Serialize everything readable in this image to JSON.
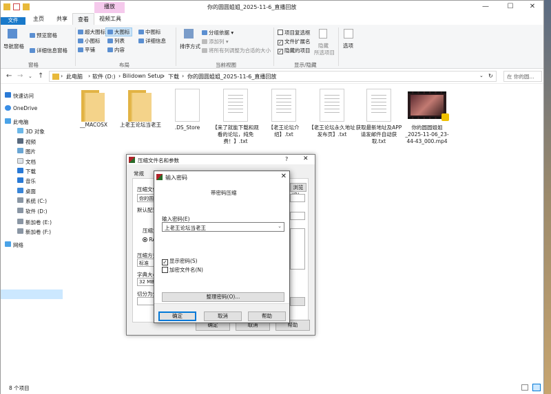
{
  "window": {
    "title": "你的圆圆姐姐_2025-11-6_直播回放",
    "context_tab": "播放",
    "caption_minimize": "—",
    "caption_maximize": "☐",
    "caption_close": "✕"
  },
  "ribbon_tabs": [
    "文件",
    "主页",
    "共享",
    "查看",
    "视频工具"
  ],
  "ribbon": {
    "nav_pane": "导航窗格",
    "preview_pane": "预览窗格",
    "details_pane": "详细信息窗格",
    "pane_group": "窗格",
    "layout_items": [
      "超大图标",
      "大图标",
      "中图标",
      "小图标",
      "列表",
      "详细信息",
      "平铺",
      "内容"
    ],
    "layout_group": "布局",
    "sort_by": "排序方式",
    "group_by": "分组依据",
    "add_columns": "添加列",
    "size_columns": "将所有列调整为合适的大小",
    "current_view_group": "当前视图",
    "item_checkboxes": "项目复选框",
    "file_extensions": "文件扩展名",
    "hidden_items": "隐藏的项目",
    "hide_selected": "隐藏",
    "hide_selected_2": "所选项目",
    "options": "选项",
    "show_hide_group": "显示/隐藏"
  },
  "address": {
    "crumbs": [
      "此电脑",
      "软件 (D:)",
      "Bilidown Setup",
      "下载",
      "你的圆圆姐姐_2025-11-6_直播回放"
    ],
    "search_placeholder": "在 你的圆..."
  },
  "sidebar": {
    "quick_access": "快速访问",
    "onedrive": "OneDrive",
    "this_pc": "此电脑",
    "items": [
      "3D 对象",
      "视频",
      "图片",
      "文档",
      "下载",
      "音乐",
      "桌面",
      "系统 (C:)",
      "软件 (D:)",
      "新加卷 (E:)",
      "新加卷 (F:)"
    ],
    "network": "网络"
  },
  "files": [
    {
      "name": "__MACOSX",
      "type": "folder"
    },
    {
      "name": "上老王论坛当老王",
      "type": "folder"
    },
    {
      "name": ".DS_Store",
      "type": "doc"
    },
    {
      "name": "【来了就能下载和观看的论坛，纯免费！】.txt",
      "type": "doc"
    },
    {
      "name": "【老王论坛介绍】.txt",
      "type": "doc"
    },
    {
      "name": "【老王论坛永久地址发布页】.txt",
      "type": "doc"
    },
    {
      "name": "获取最新地址及APP请发邮件自动获取.txt",
      "type": "doc"
    },
    {
      "name": "你的圆圆姐姐_2025-11-06_23-44-43_000.mp4",
      "type": "video"
    }
  ],
  "status": {
    "count": "8 个项目"
  },
  "archive_dialog": {
    "title": "压缩文件名和参数",
    "help_icon": "?",
    "close_icon": "✕",
    "tab_general": "常规",
    "tab_advanced": "高",
    "filename_label": "压缩文件",
    "filename_value": "你的圆圆",
    "browse_button": "浏览(B)...",
    "default_profile": "默认配置",
    "format_label": "压缩文",
    "format_rar": "RA",
    "method_label": "压缩方式",
    "method_value": "标准",
    "dict_label": "字典大小",
    "dict_value": "32 MB",
    "split_label": "切分为分",
    "ok_button": "确定",
    "cancel_button": "取消",
    "help_button": "帮助"
  },
  "password_dialog": {
    "title": "输入密码",
    "close_icon": "✕",
    "heading": "带密码压缩",
    "enter_label": "输入密码(E)",
    "password_value": "上老王论坛当老王",
    "show_password": "显示密码(S)",
    "encrypt_names": "加密文件名(N)",
    "organize_button": "整理密码(O)...",
    "ok_button": "确定",
    "cancel_button": "取消",
    "help_button": "帮助"
  }
}
